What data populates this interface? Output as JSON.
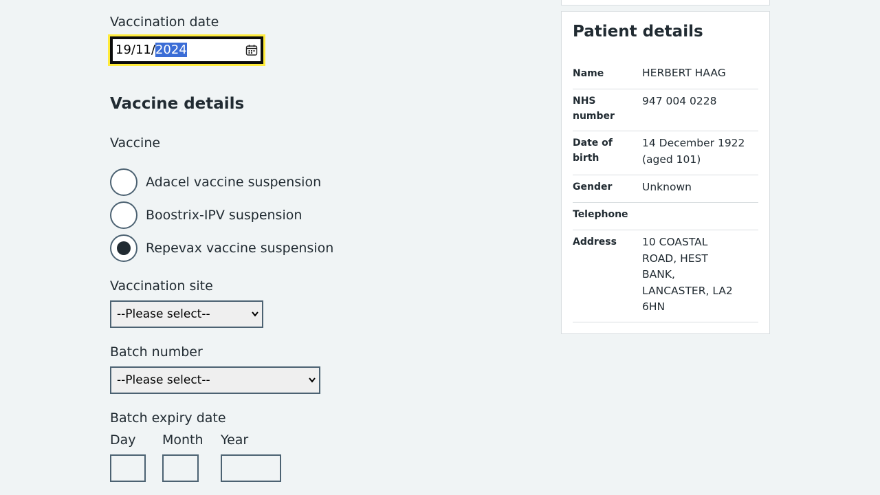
{
  "form": {
    "vaccination_date_label": "Vaccination date",
    "vaccination_date_prefix": "19/11/",
    "vaccination_date_year": "2024",
    "vaccine_details_heading": "Vaccine details",
    "vaccine_label": "Vaccine",
    "vaccines": [
      {
        "label": "Adacel vaccine suspension",
        "checked": false
      },
      {
        "label": "Boostrix-IPV suspension",
        "checked": false
      },
      {
        "label": "Repevax vaccine suspension",
        "checked": true
      }
    ],
    "site_label": "Vaccination site",
    "site_value": "--Please select--",
    "batch_label": "Batch number",
    "batch_value": "--Please select--",
    "expiry_label": "Batch expiry date",
    "day_label": "Day",
    "month_label": "Month",
    "year_label": "Year"
  },
  "patient": {
    "title": "Patient details",
    "rows": [
      {
        "key": "Name",
        "value": "HERBERT HAAG"
      },
      {
        "key": "NHS number",
        "value": "947 004 0228"
      },
      {
        "key": "Date of birth",
        "value": "14 December 1922 (aged 101)"
      },
      {
        "key": "Gender",
        "value": "Unknown"
      },
      {
        "key": "Telephone",
        "value": ""
      },
      {
        "key": "Address",
        "value": "10 COASTAL ROAD, HEST BANK, LANCASTER, LA2 6HN"
      }
    ]
  },
  "colors": {
    "background": "#f0f4f5",
    "focus": "#ffeb3b",
    "text": "#212b32",
    "border": "#4c6272",
    "selection": "#3b6dd6"
  },
  "icons": {
    "calendar": "calendar-icon",
    "select_arrow": "chevron-down-icon"
  }
}
